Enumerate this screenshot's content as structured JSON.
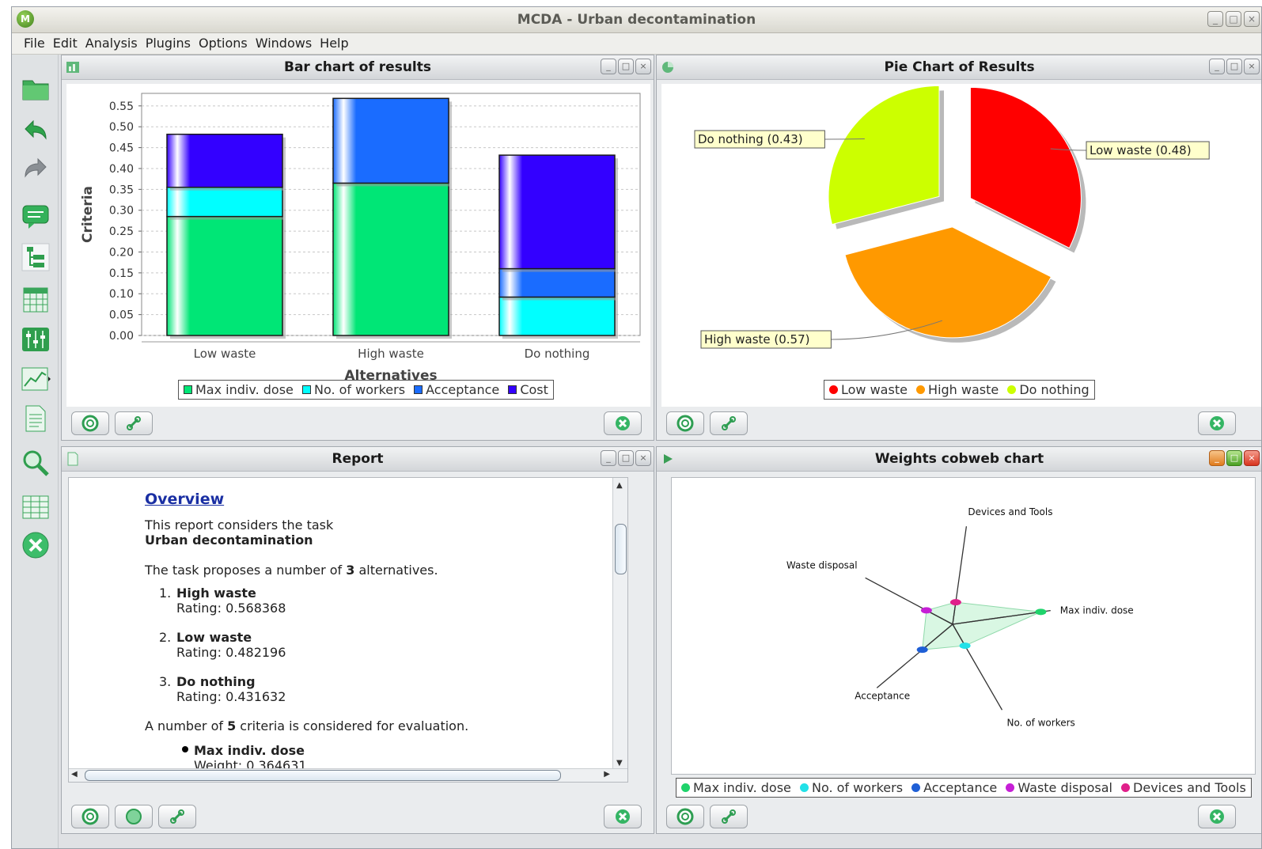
{
  "window": {
    "title": "MCDA - Urban decontamination",
    "logo_letter": "M"
  },
  "menu": [
    "File",
    "Edit",
    "Analysis",
    "Plugins",
    "Options",
    "Windows",
    "Help"
  ],
  "panels": {
    "bar": {
      "title": "Bar chart of results"
    },
    "pie": {
      "title": "Pie Chart of Results"
    },
    "report": {
      "title": "Report"
    },
    "cobweb": {
      "title": "Weights cobweb chart"
    }
  },
  "report": {
    "heading": "Overview",
    "intro1": "This report considers the task",
    "task": "Urban decontamination",
    "alt_pre": "The task proposes a number of ",
    "alt_num": "3",
    "alt_post": " alternatives.",
    "alternatives": [
      {
        "num": "1.",
        "name": "High waste",
        "rating": "Rating: 0.568368"
      },
      {
        "num": "2.",
        "name": "Low waste",
        "rating": "Rating: 0.482196"
      },
      {
        "num": "3.",
        "name": "Do nothing",
        "rating": "Rating: 0.431632"
      }
    ],
    "crit_pre": "A number of ",
    "crit_num": "5",
    "crit_post": " criteria is considered for evaluation.",
    "criterion": {
      "name": "Max indiv. dose",
      "weight": "Weight: 0.364631"
    }
  },
  "colors": {
    "max_dose": "#00e676",
    "workers": "#00ffff",
    "acceptance": "#1a6cff",
    "cost": "#3300ff",
    "low_waste": "#ff0000",
    "high_waste": "#ff9900",
    "do_nothing": "#ccff00"
  },
  "chart_data": [
    {
      "type": "bar",
      "stacked": true,
      "title": "",
      "xlabel": "Alternatives",
      "ylabel": "Criteria",
      "categories": [
        "Low waste",
        "High waste",
        "Do nothing"
      ],
      "ylim": [
        0,
        0.58
      ],
      "yticks": [
        "0.00",
        "0.05",
        "0.10",
        "0.15",
        "0.20",
        "0.25",
        "0.30",
        "0.35",
        "0.40",
        "0.45",
        "0.50",
        "0.55"
      ],
      "series": [
        {
          "name": "Max indiv. dose",
          "values": [
            0.285,
            0.365,
            0.0
          ]
        },
        {
          "name": "No. of workers",
          "values": [
            0.07,
            0.0,
            0.092
          ]
        },
        {
          "name": "Acceptance",
          "values": [
            0.0,
            0.203,
            0.068
          ]
        },
        {
          "name": "Cost",
          "values": [
            0.127,
            0.0,
            0.272
          ]
        }
      ],
      "legend_position": "bottom"
    },
    {
      "type": "pie",
      "title": "",
      "labels": [
        "Low waste",
        "High waste",
        "Do nothing"
      ],
      "values": [
        0.48,
        0.57,
        0.43
      ],
      "slice_labels": [
        "Low waste (0.48)",
        "High waste (0.57)",
        "Do nothing (0.43)"
      ],
      "legend_position": "bottom"
    },
    {
      "type": "radar",
      "title": "",
      "axes": [
        "Devices and Tools",
        "Max indiv. dose",
        "No. of workers",
        "Acceptance",
        "Waste disposal"
      ],
      "values": [
        0.09,
        0.36,
        0.1,
        0.16,
        0.12
      ],
      "legend": [
        "Max indiv. dose",
        "No. of workers",
        "Acceptance",
        "Waste disposal",
        "Devices and Tools"
      ],
      "legend_position": "bottom"
    }
  ]
}
